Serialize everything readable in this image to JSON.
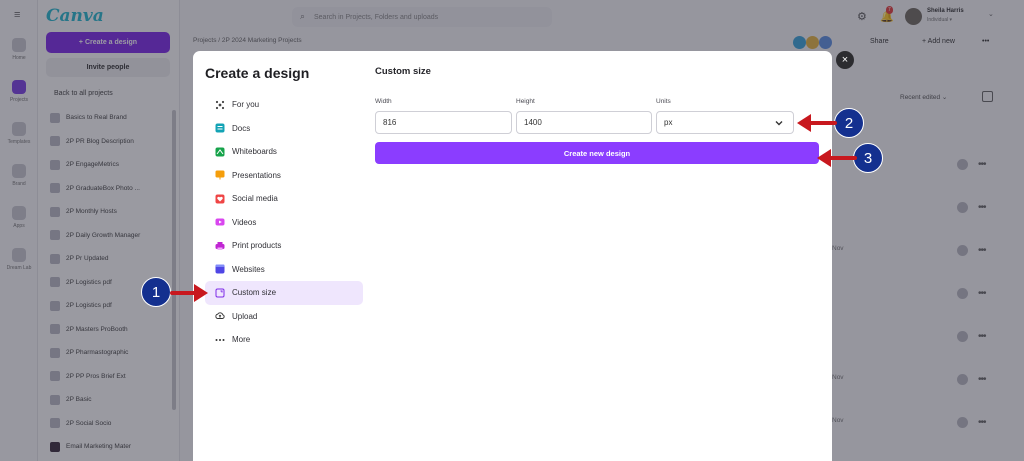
{
  "app": {
    "logo": "Canva",
    "menu_glyph": "≡",
    "rail": [
      {
        "label": "Home",
        "icon": "home-icon"
      },
      {
        "label": "Projects",
        "icon": "projects-icon",
        "active": true
      },
      {
        "label": "Templates",
        "icon": "templates-icon"
      },
      {
        "label": "Brand",
        "icon": "brand-icon"
      },
      {
        "label": "Apps",
        "icon": "apps-icon"
      },
      {
        "label": "Dream Lab",
        "icon": "dream-lab-icon"
      }
    ],
    "sidebar": {
      "create_button": "+ Create a design",
      "invite_button": "Invite people",
      "back_link": "Back to all projects",
      "projects": [
        "Basics to Real Brand",
        "2P PR Blog Description",
        "2P EngageMetrics",
        "2P GraduateBox Photo ...",
        "2P Monthly Hosts",
        "2P Daily Growth Manager",
        "2P Pr Updated",
        "2P Logistics pdf",
        "2P Logistics pdf",
        "2P Masters ProBooth",
        "2P Pharmastographic",
        "2P PP Pros Brief Ext",
        "2P Basic",
        "2P Social Socio",
        "Email Marketing Mater"
      ]
    },
    "search_placeholder": "Search in Projects, Folders and uploads",
    "search_glyph": "⌕",
    "top_icons": [
      "⚙",
      "🔔"
    ],
    "notification_count": "7",
    "user": {
      "name": "Sheila Harris",
      "sub": "Individual ▾",
      "chevron": "⌄"
    },
    "breadcrumb": "Projects  /  2P 2024 Marketing Projects",
    "header_actions": [
      "Share",
      "+ Add new",
      "•••"
    ],
    "sort_label": "Recent edited  ⌄",
    "row_dates": [
      "",
      "",
      "",
      "Nov",
      "",
      "",
      "Nov",
      "",
      "",
      "Nov"
    ],
    "row_dots": "•••"
  },
  "modal": {
    "title": "Create a design",
    "close_glyph": "×",
    "categories": [
      {
        "label": "For you",
        "icon": "sparkle-icon"
      },
      {
        "label": "Docs",
        "icon": "docs-icon"
      },
      {
        "label": "Whiteboards",
        "icon": "whiteboard-icon"
      },
      {
        "label": "Presentations",
        "icon": "presentation-icon"
      },
      {
        "label": "Social media",
        "icon": "social-media-icon"
      },
      {
        "label": "Videos",
        "icon": "video-icon"
      },
      {
        "label": "Print products",
        "icon": "print-icon"
      },
      {
        "label": "Websites",
        "icon": "website-icon"
      },
      {
        "label": "Custom size",
        "icon": "custom-size-icon",
        "selected": true
      },
      {
        "label": "Upload",
        "icon": "upload-icon"
      },
      {
        "label": "More",
        "icon": "more-icon"
      }
    ],
    "panel": {
      "title": "Custom size",
      "width_label": "Width",
      "width_value": "816",
      "height_label": "Height",
      "height_value": "1400",
      "units_label": "Units",
      "units_value": "px",
      "create_button": "Create new design"
    }
  },
  "annotations": {
    "step1": "1",
    "step2": "2",
    "step3": "3",
    "arrow_color": "#c8181e",
    "circle_color": "#14308f"
  },
  "colors": {
    "accent": "#8b3dff",
    "selected_bg": "#efe6fd",
    "logo": "#25b8cd"
  }
}
